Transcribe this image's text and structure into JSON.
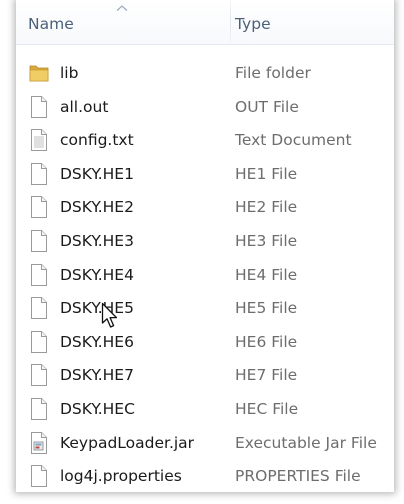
{
  "columns": {
    "name": "Name",
    "type": "Type"
  },
  "files": [
    {
      "name": "lib",
      "type": "File folder",
      "icon": "folder-icon"
    },
    {
      "name": "all.out",
      "type": "OUT File",
      "icon": "file-icon"
    },
    {
      "name": "config.txt",
      "type": "Text Document",
      "icon": "text-file-icon"
    },
    {
      "name": "DSKY.HE1",
      "type": "HE1 File",
      "icon": "file-icon"
    },
    {
      "name": "DSKY.HE2",
      "type": "HE2 File",
      "icon": "file-icon"
    },
    {
      "name": "DSKY.HE3",
      "type": "HE3 File",
      "icon": "file-icon"
    },
    {
      "name": "DSKY.HE4",
      "type": "HE4 File",
      "icon": "file-icon"
    },
    {
      "name": "DSKY.HE5",
      "type": "HE5 File",
      "icon": "file-icon"
    },
    {
      "name": "DSKY.HE6",
      "type": "HE6 File",
      "icon": "file-icon"
    },
    {
      "name": "DSKY.HE7",
      "type": "HE7 File",
      "icon": "file-icon"
    },
    {
      "name": "DSKY.HEC",
      "type": "HEC File",
      "icon": "file-icon"
    },
    {
      "name": "KeypadLoader.jar",
      "type": "Executable Jar File",
      "icon": "jar-file-icon"
    },
    {
      "name": "log4j.properties",
      "type": "PROPERTIES File",
      "icon": "file-icon"
    }
  ],
  "colors": {
    "header_text": "#4c607a",
    "name_text": "#1a1a1a",
    "type_text": "#6d6d6d",
    "folder": "#e8c45a"
  }
}
